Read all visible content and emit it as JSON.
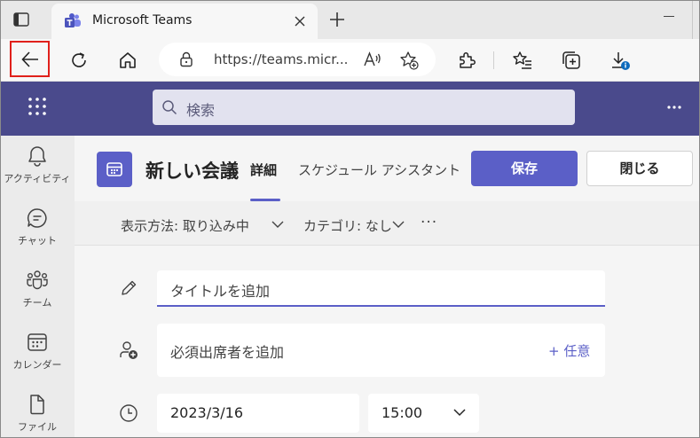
{
  "browser": {
    "tab_title": "Microsoft Teams",
    "url": "https://teams.micr...",
    "icons": [
      "tab-actions-icon",
      "teams-favicon",
      "close-icon",
      "new-tab-icon",
      "back-arrow-icon",
      "refresh-icon",
      "home-icon",
      "lock-icon",
      "read-aloud-icon",
      "add-favorite-icon",
      "extensions-icon",
      "favorites-icon",
      "collections-icon",
      "downloads-icon"
    ]
  },
  "header": {
    "search_placeholder": "検索"
  },
  "rail": {
    "items": [
      {
        "label": "アクティビティ",
        "icon": "bell-icon"
      },
      {
        "label": "チャット",
        "icon": "chat-icon"
      },
      {
        "label": "チーム",
        "icon": "teams-icon"
      },
      {
        "label": "カレンダー",
        "icon": "calendar-icon"
      },
      {
        "label": "ファイル",
        "icon": "file-icon"
      }
    ]
  },
  "meeting": {
    "title": "新しい会議",
    "tab_details": "詳細",
    "tab_assistant": "スケジュール アシスタント",
    "save_label": "保存",
    "close_label": "閉じる",
    "show_as": "表示方法: 取り込み中",
    "category": "カテゴリ: なし",
    "more": "···",
    "title_placeholder": "タイトルを追加",
    "attendees_placeholder": "必須出席者を追加",
    "optional_label": "+ 任意",
    "date": "2023/3/16",
    "time": "15:00"
  },
  "colors": {
    "teams_header": "#4a4a8c",
    "accent": "#5b5fc7",
    "highlight_border": "#e0201b"
  }
}
